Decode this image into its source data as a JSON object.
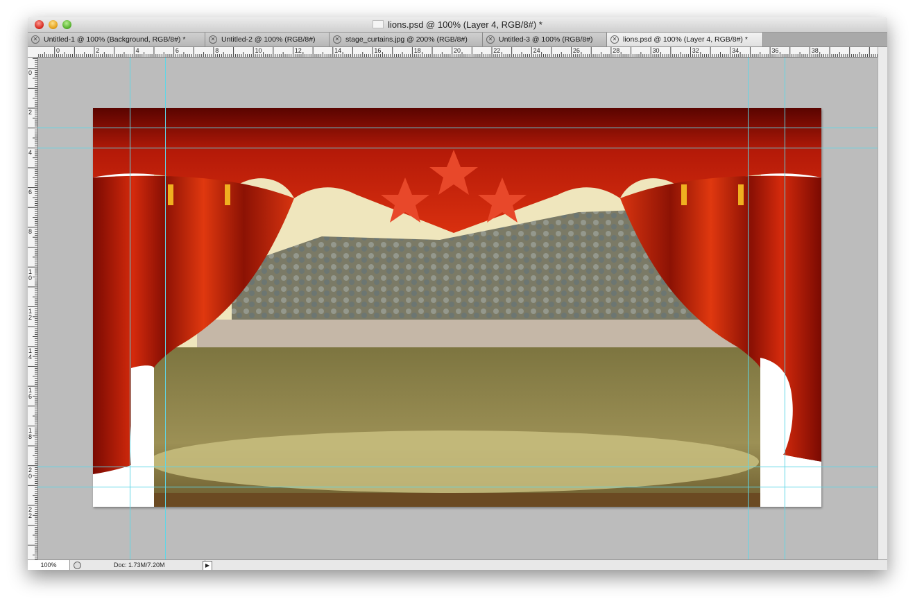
{
  "window": {
    "title": "lions.psd @ 100% (Layer 4, RGB/8#) *"
  },
  "tabs": [
    {
      "label": "Untitled-1 @ 100% (Background, RGB/8#) *",
      "active": false
    },
    {
      "label": "Untitled-2 @ 100% (RGB/8#)",
      "active": false
    },
    {
      "label": "stage_curtains.jpg @ 200% (RGB/8#)",
      "active": false
    },
    {
      "label": "Untitled-3 @ 100% (RGB/8#)",
      "active": false
    },
    {
      "label": "lions.psd @ 100% (Layer 4, RGB/8#) *",
      "active": true
    }
  ],
  "ruler_top": {
    "labels": [
      "2",
      "0",
      "2",
      "4",
      "6",
      "8",
      "10",
      "12",
      "14",
      "16",
      "18",
      "20",
      "22",
      "24",
      "26",
      "28",
      "30",
      "32",
      "34",
      "36",
      "38"
    ]
  },
  "ruler_left": {
    "labels": [
      "2",
      "0",
      "2",
      "4",
      "6",
      "8",
      "1\n0",
      "1\n2",
      "1\n4",
      "1\n6",
      "1\n8",
      "2\n0",
      "2\n2"
    ]
  },
  "status": {
    "zoom": "100%",
    "doc": "Doc: 1.73M/7.20M"
  },
  "icons": {
    "close": "close-icon",
    "arrow": "play-arrow-icon"
  },
  "colors": {
    "guide": "#5fd6e6",
    "curtain": "#c81e0a",
    "pasteboard": "#bcbcbc"
  }
}
